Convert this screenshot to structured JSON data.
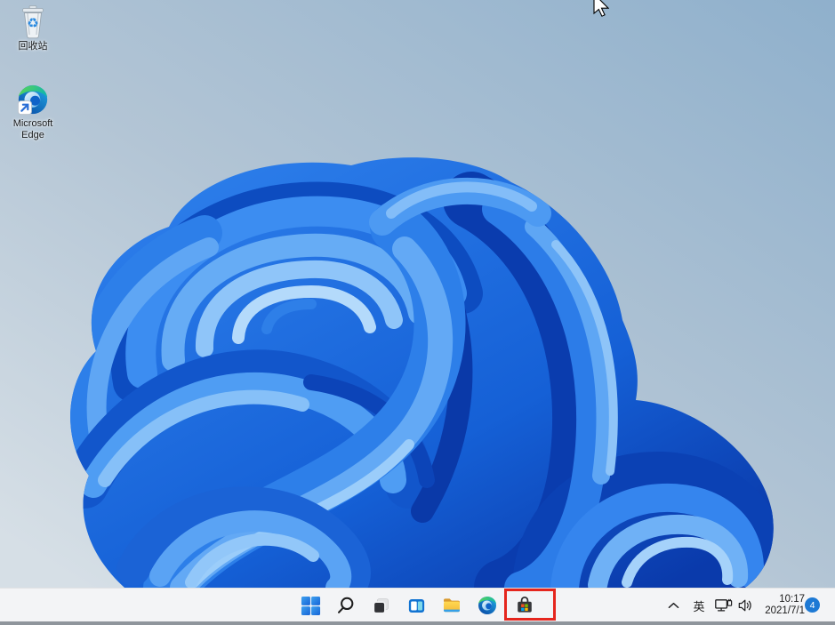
{
  "wallpaper": {
    "name": "windows-11-bloom",
    "colors": {
      "sky_top": "#8fb0cc",
      "sky_bottom": "#d4dee6",
      "bloom_deep": "#0a3cae",
      "bloom_mid": "#2e7fe9",
      "bloom_light": "#8fc5f9"
    }
  },
  "desktop": {
    "icons": [
      {
        "name": "recycle-bin",
        "icon": "recycle-bin-icon",
        "label": "回收站"
      },
      {
        "name": "microsoft-edge-shortcut",
        "icon": "edge-icon",
        "label": "Microsoft Edge"
      }
    ]
  },
  "cursor": {
    "icon": "arrow-pointer-icon"
  },
  "taskbar": {
    "background": "#f3f4f6",
    "buttons": [
      {
        "name": "start",
        "icon": "windows-logo-icon"
      },
      {
        "name": "search",
        "icon": "search-icon"
      },
      {
        "name": "task-view",
        "icon": "task-view-icon"
      },
      {
        "name": "widgets",
        "icon": "widgets-icon"
      },
      {
        "name": "file-explorer",
        "icon": "folder-icon"
      },
      {
        "name": "microsoft-edge",
        "icon": "edge-icon"
      },
      {
        "name": "microsoft-store",
        "icon": "store-bag-icon",
        "highlighted": true
      }
    ],
    "tray": {
      "hidden_icons": "chevron-up-icon",
      "ime_label": "英",
      "icons": [
        "network-icon",
        "volume-icon"
      ],
      "clock": {
        "time": "10:17",
        "date": "2021/7/1"
      },
      "notification_badge": "4"
    }
  },
  "annotation": {
    "type": "highlight-box",
    "target": "microsoft-store-button",
    "color": "#e5261e"
  }
}
